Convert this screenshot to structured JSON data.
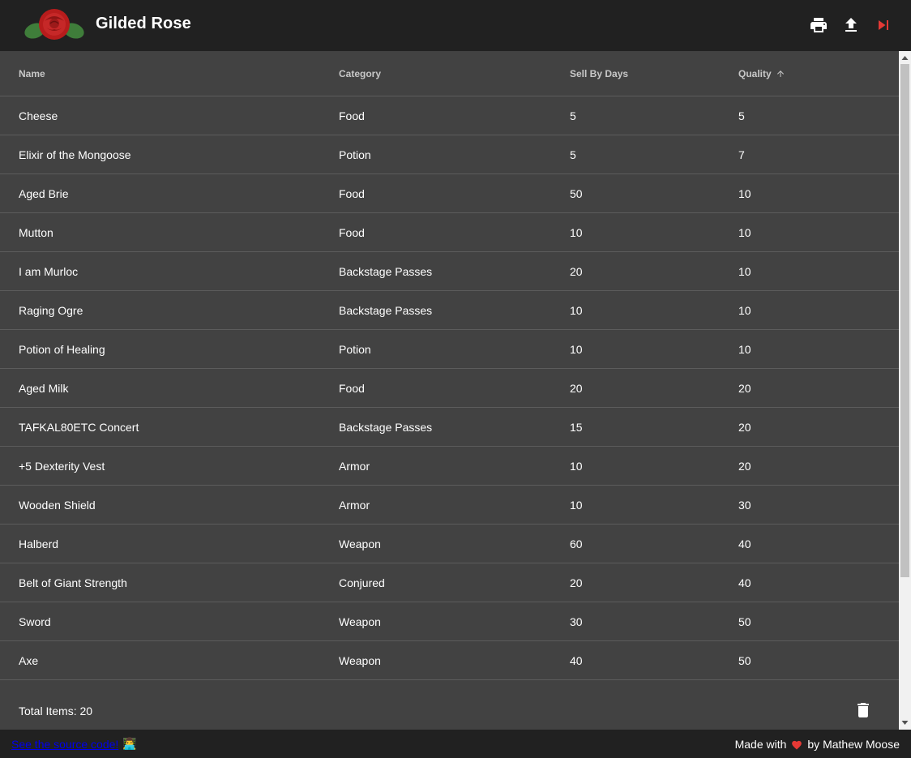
{
  "app": {
    "title": "Gilded Rose"
  },
  "toolbar": {
    "print_icon": "print-icon",
    "upload_icon": "upload-icon",
    "skip_icon": "skip-next-icon"
  },
  "table": {
    "columns": [
      "Name",
      "Category",
      "Sell By Days",
      "Quality"
    ],
    "sort_column": "Quality",
    "sort_direction": "ascending",
    "rows": [
      {
        "name": "Cheese",
        "category": "Food",
        "sell_by": "5",
        "quality": "5"
      },
      {
        "name": "Elixir of the Mongoose",
        "category": "Potion",
        "sell_by": "5",
        "quality": "7"
      },
      {
        "name": "Aged Brie",
        "category": "Food",
        "sell_by": "50",
        "quality": "10"
      },
      {
        "name": "Mutton",
        "category": "Food",
        "sell_by": "10",
        "quality": "10"
      },
      {
        "name": "I am Murloc",
        "category": "Backstage Passes",
        "sell_by": "20",
        "quality": "10"
      },
      {
        "name": "Raging Ogre",
        "category": "Backstage Passes",
        "sell_by": "10",
        "quality": "10"
      },
      {
        "name": "Potion of Healing",
        "category": "Potion",
        "sell_by": "10",
        "quality": "10"
      },
      {
        "name": "Aged Milk",
        "category": "Food",
        "sell_by": "20",
        "quality": "20"
      },
      {
        "name": "TAFKAL80ETC Concert",
        "category": "Backstage Passes",
        "sell_by": "15",
        "quality": "20"
      },
      {
        "name": "+5 Dexterity Vest",
        "category": "Armor",
        "sell_by": "10",
        "quality": "20"
      },
      {
        "name": "Wooden Shield",
        "category": "Armor",
        "sell_by": "10",
        "quality": "30"
      },
      {
        "name": "Halberd",
        "category": "Weapon",
        "sell_by": "60",
        "quality": "40"
      },
      {
        "name": "Belt of Giant Strength",
        "category": "Conjured",
        "sell_by": "20",
        "quality": "40"
      },
      {
        "name": "Sword",
        "category": "Weapon",
        "sell_by": "30",
        "quality": "50"
      },
      {
        "name": "Axe",
        "category": "Weapon",
        "sell_by": "40",
        "quality": "50"
      }
    ],
    "total_label": "Total Items: 20"
  },
  "footer": {
    "source_link": "See the source code!",
    "laptop_emoji": "👨‍💻",
    "made_with": "Made with",
    "by": "by Mathew Moose"
  },
  "colors": {
    "appbar": "#212121",
    "surface": "#424242",
    "accent_red": "#e53935"
  }
}
